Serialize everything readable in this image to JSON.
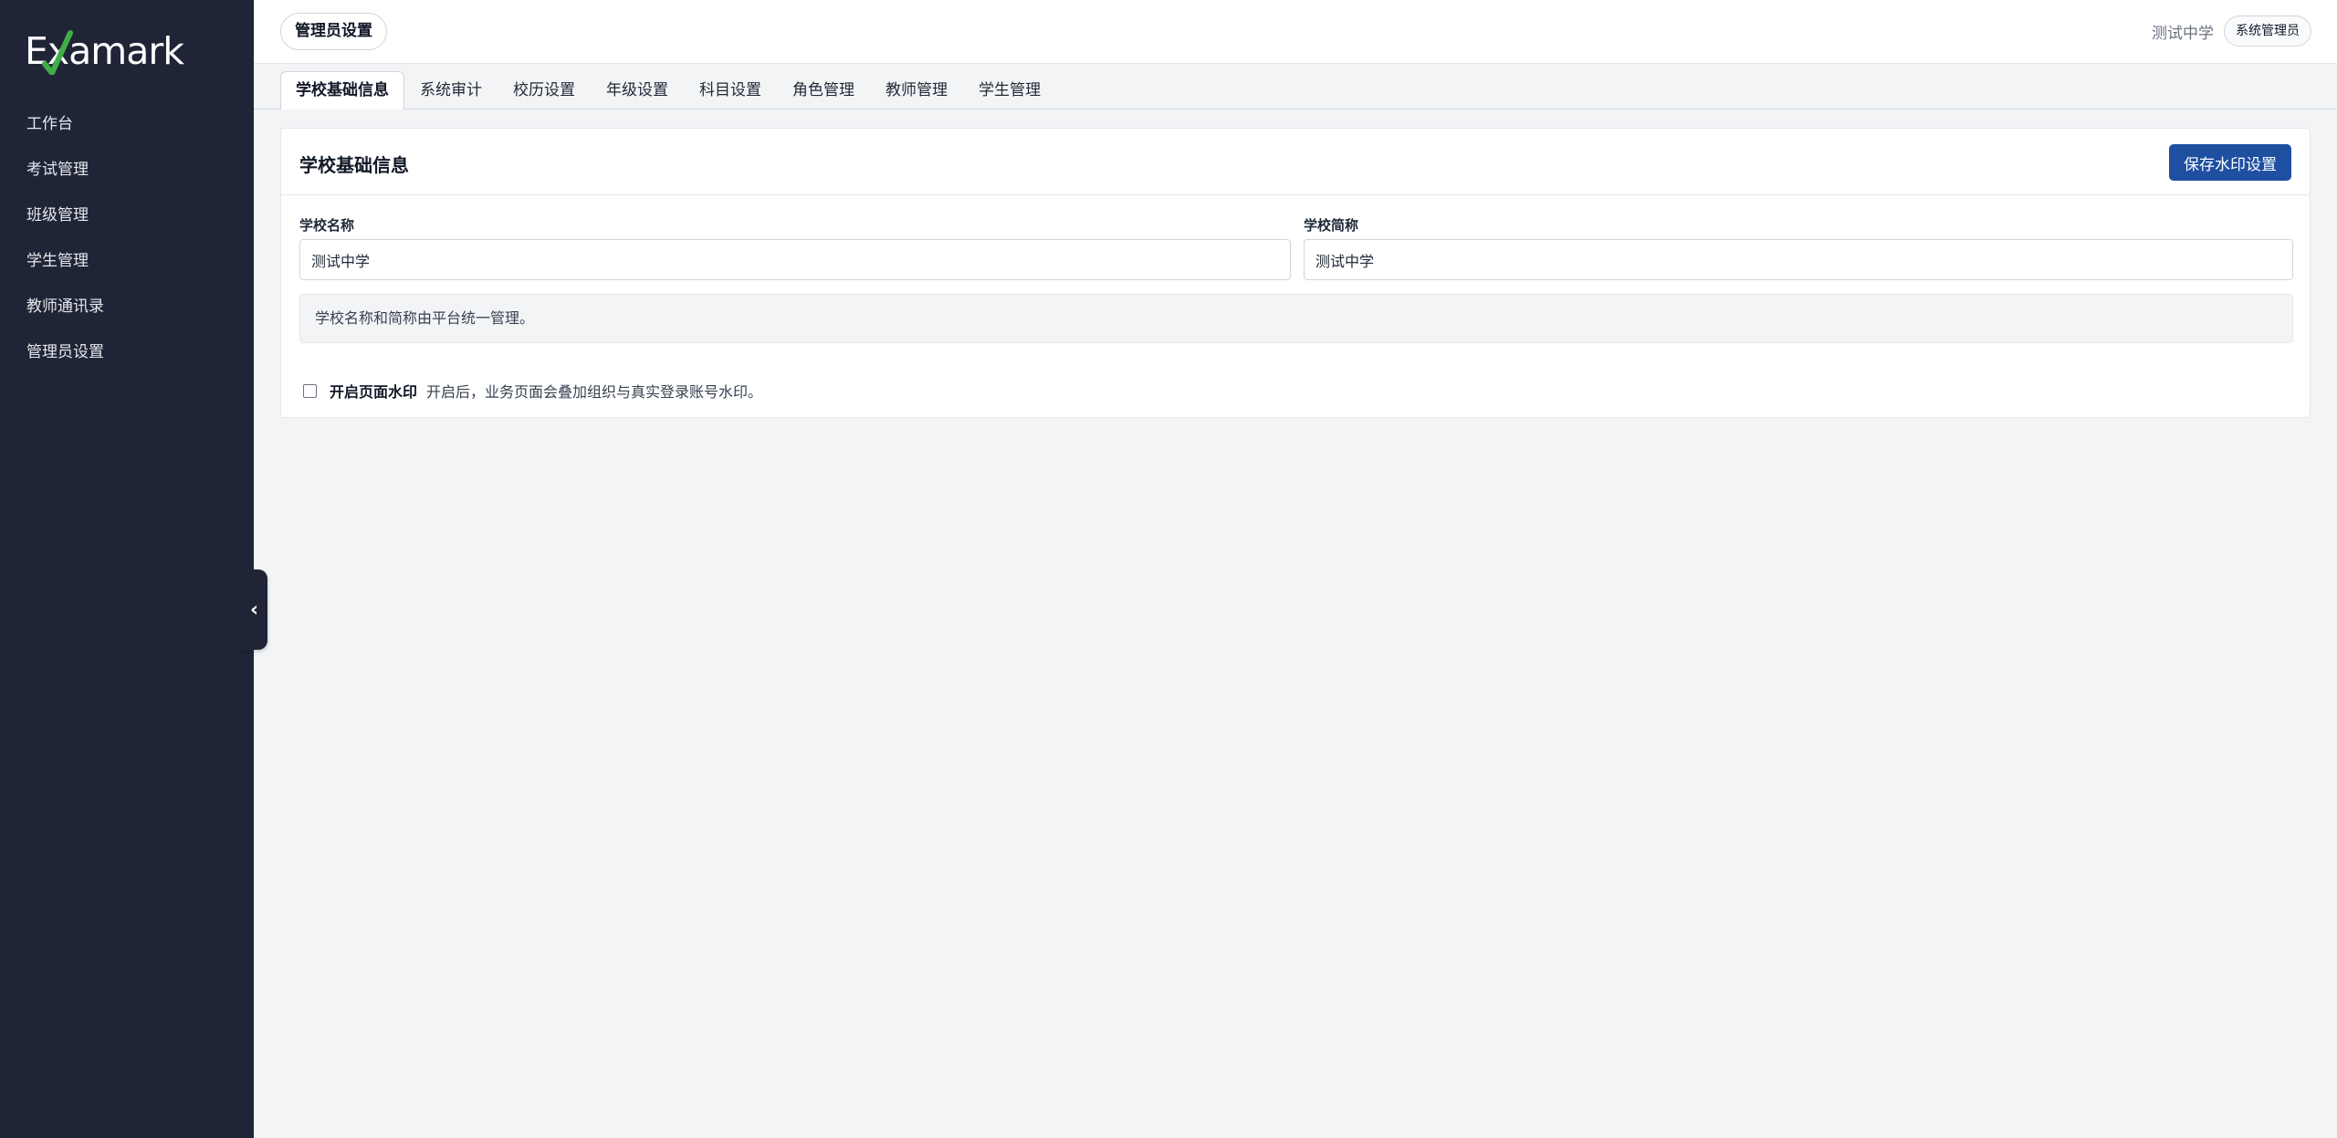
{
  "brand": {
    "logo_text": "Examark"
  },
  "sidebar": {
    "items": [
      {
        "label": "工作台"
      },
      {
        "label": "考试管理"
      },
      {
        "label": "班级管理"
      },
      {
        "label": "学生管理"
      },
      {
        "label": "教师通讯录"
      },
      {
        "label": "管理员设置"
      }
    ],
    "collapse_icon": "chevron-left-icon"
  },
  "topbar": {
    "page_title": "管理员设置",
    "school_name": "测试中学",
    "role": "系统管理员"
  },
  "tabs": [
    {
      "label": "学校基础信息",
      "active": true
    },
    {
      "label": "系统审计",
      "active": false
    },
    {
      "label": "校历设置",
      "active": false
    },
    {
      "label": "年级设置",
      "active": false
    },
    {
      "label": "科目设置",
      "active": false
    },
    {
      "label": "角色管理",
      "active": false
    },
    {
      "label": "教师管理",
      "active": false
    },
    {
      "label": "学生管理",
      "active": false
    }
  ],
  "card": {
    "title": "学校基础信息",
    "save_label": "保存水印设置",
    "school_name_label": "学校名称",
    "school_name_value": "测试中学",
    "school_short_label": "学校简称",
    "school_short_value": "测试中学",
    "notice": "学校名称和简称由平台统一管理。",
    "watermark_label": "开启页面水印",
    "watermark_desc": "开启后，业务页面会叠加组织与真实登录账号水印。",
    "watermark_checked": false
  },
  "colors": {
    "sidebar_bg": "#1f2537",
    "primary": "#1e4fa1",
    "logo_check": "#3fae49"
  }
}
